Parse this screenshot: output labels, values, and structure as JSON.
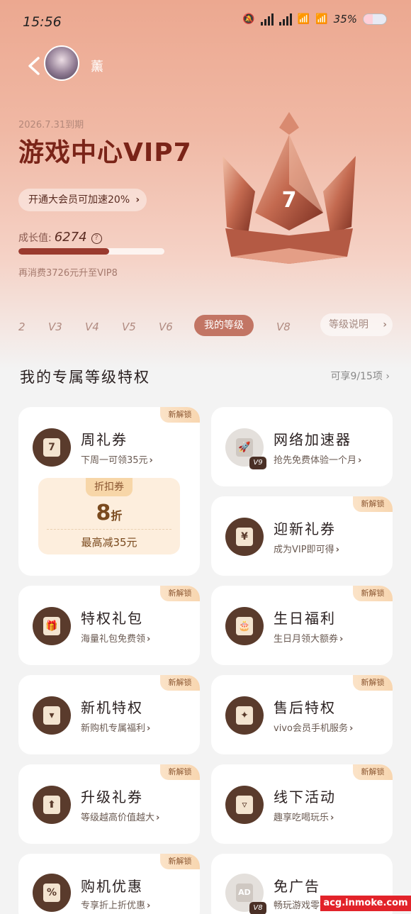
{
  "status_bar": {
    "time": "15:56",
    "battery_text": "35%",
    "net1": "5G",
    "net2": "5G"
  },
  "header": {
    "username": "薰"
  },
  "vip": {
    "expiry": "2026.7.31到期",
    "title": "游戏中心VIP7",
    "speed_up": "开通大会员可加速20%",
    "growth_label": "成长值:",
    "growth_value": "6274",
    "progress_fraction": 0.62,
    "upgrade_hint": "再消费3726元升至VIP8",
    "crown_level": "7"
  },
  "levels": {
    "items": [
      "2",
      "V3",
      "V4",
      "V5",
      "V6"
    ],
    "current": "我的等级",
    "next": "V8",
    "explain": "等级说明"
  },
  "section": {
    "title": "我的专属等级特权",
    "count": "可享9/15项"
  },
  "badge_text": "新解锁",
  "cards": [
    {
      "title": "周礼券",
      "sub": "下周一可领35元",
      "icon": "ticket-icon",
      "glyph": "7"
    },
    {
      "title": "网络加速器",
      "sub": "抢先免费体验一个月",
      "icon": "rocket-icon",
      "glyph": "🚀",
      "vtag": "V9"
    },
    {
      "title": "迎新礼券",
      "sub": "成为VIP即可得",
      "icon": "yen-ticket-icon",
      "glyph": "¥"
    },
    {
      "title": "特权礼包",
      "sub": "海量礼包免费领",
      "icon": "gift-box-icon",
      "glyph": "🎁"
    },
    {
      "title": "生日福利",
      "sub": "生日月领大额券",
      "icon": "birthday-cake-icon",
      "glyph": "🎂"
    },
    {
      "title": "新机特权",
      "sub": "新购机专属福利",
      "icon": "phone-icon",
      "glyph": "▾"
    },
    {
      "title": "售后特权",
      "sub": "vivo会员手机服务",
      "icon": "wrench-icon",
      "glyph": "✦"
    },
    {
      "title": "升级礼券",
      "sub": "等级越高价值越大",
      "icon": "upgrade-icon",
      "glyph": "⬆"
    },
    {
      "title": "线下活动",
      "sub": "趣享吃喝玩乐",
      "icon": "store-icon",
      "glyph": "▿"
    },
    {
      "title": "购机优惠",
      "sub": "专享折上折优惠",
      "icon": "discount-icon",
      "glyph": "%"
    },
    {
      "title": "免广告",
      "sub": "畅玩游戏零打扰",
      "icon": "ad-free-icon",
      "glyph": "AD",
      "vtag": "V8"
    }
  ],
  "coupon": {
    "tag": "折扣券",
    "value": "8",
    "unit": "折",
    "max": "最高减35元"
  },
  "watermark": "acg.inmoke.com",
  "colors": {
    "accent": "#7a2418",
    "card_icon": "#5a3b2c",
    "level_pill": "#c27564"
  }
}
